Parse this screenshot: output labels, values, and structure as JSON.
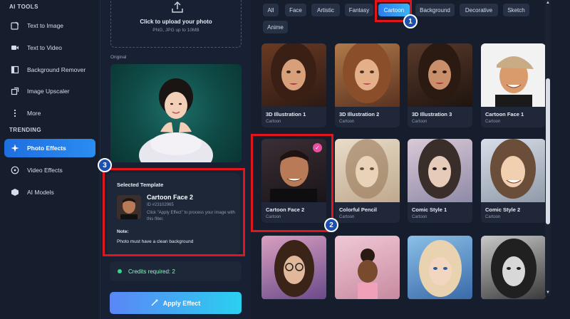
{
  "sidebar": {
    "section_ai_tools": "AI TOOLS",
    "section_trending": "TRENDING",
    "items": [
      {
        "label": "Text to Image",
        "icon": "image-edit-icon"
      },
      {
        "label": "Text to Video",
        "icon": "video-icon"
      },
      {
        "label": "Background Remover",
        "icon": "columns-icon"
      },
      {
        "label": "Image Upscaler",
        "icon": "upscale-icon"
      },
      {
        "label": "More",
        "icon": "more-vertical-icon"
      },
      {
        "label": "Photo Effects",
        "icon": "sparkle-icon",
        "active": true
      },
      {
        "label": "Video Effects",
        "icon": "film-icon"
      },
      {
        "label": "AI Models",
        "icon": "cube-icon"
      }
    ]
  },
  "upload": {
    "title": "Click to upload your photo",
    "subtitle": "PNG, JPG up to 10MB",
    "original_label": "Original"
  },
  "template": {
    "heading": "Selected Template",
    "name": "Cartoon Face 2",
    "id": "ID #23102965",
    "description": "Click \"Apply Effect\" to process your image with this filter.",
    "note_label": "Note:",
    "note": "Photo must have a clean background"
  },
  "credits": "Credits required: 2",
  "apply_label": "Apply Effect",
  "filters": [
    "All",
    "Face",
    "Artistic",
    "Fantasy",
    "Cartoon",
    "Background",
    "Decorative",
    "Sketch",
    "Anime"
  ],
  "active_filter": "Cartoon",
  "cards": [
    {
      "title": "3D Illustration 1",
      "category": "Cartoon"
    },
    {
      "title": "3D Illustration 2",
      "category": "Cartoon"
    },
    {
      "title": "3D Illustration 3",
      "category": "Cartoon"
    },
    {
      "title": "Cartoon Face 1",
      "category": "Cartoon"
    },
    {
      "title": "Cartoon Face 2",
      "category": "Cartoon",
      "selected": true
    },
    {
      "title": "Colorful Pencil",
      "category": "Cartoon"
    },
    {
      "title": "Comic Style 1",
      "category": "Cartoon"
    },
    {
      "title": "Comic Style 2",
      "category": "Cartoon"
    },
    {
      "title": "",
      "category": ""
    },
    {
      "title": "",
      "category": ""
    },
    {
      "title": "",
      "category": ""
    },
    {
      "title": "",
      "category": ""
    }
  ],
  "annotations": [
    "1",
    "2",
    "3"
  ],
  "colors": {
    "accent": "#2a7df0",
    "highlight": "#e0161c",
    "badge": "#1b4fb0",
    "check": "#e94fa0"
  }
}
